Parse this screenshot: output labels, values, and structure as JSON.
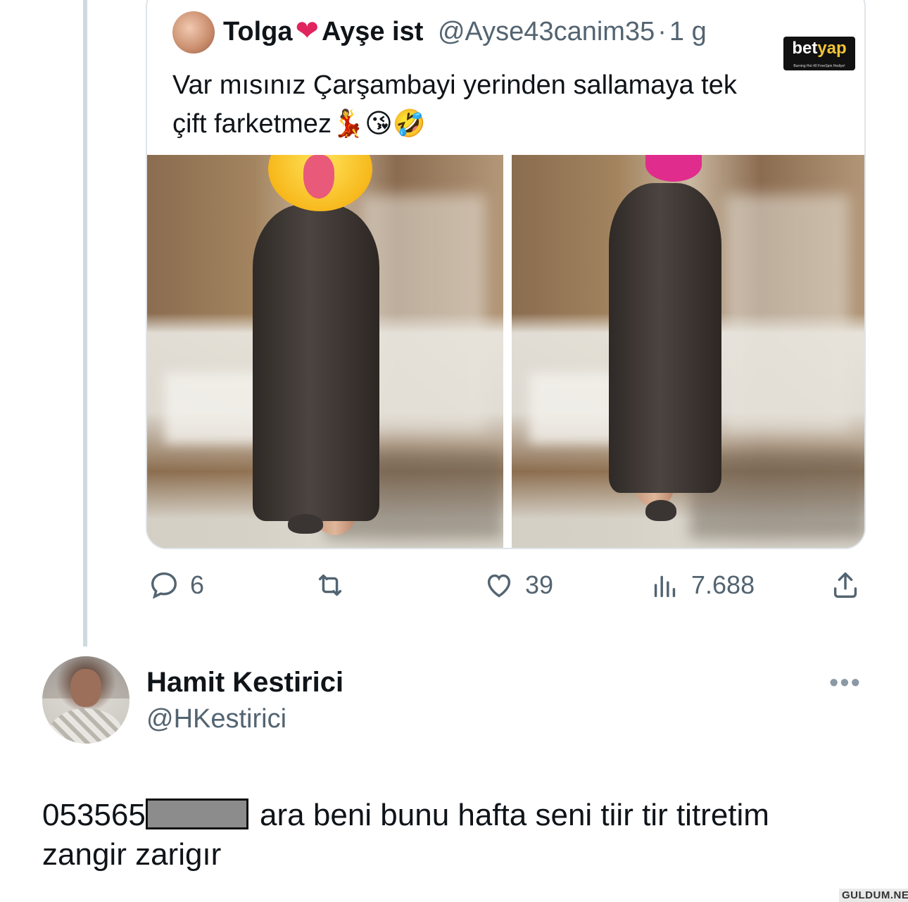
{
  "quoted_tweet": {
    "display_name": "Tolga",
    "display_name_2": "Ayşe ist",
    "handle": "@Ayse43canim35",
    "separator": "·",
    "time": "1 g",
    "text_line1": "Var mısınız Çarşambayi yerinden sallamaya tek",
    "text_line2": "çift farketmez",
    "text_emojis": "💃😘🤣",
    "heart": "❤"
  },
  "ad_badge": {
    "brand_a": "bet",
    "brand_b": "yap",
    "tagline": "Burning Hot 40 FreeSpin Hediye!"
  },
  "actions": {
    "replies": "6",
    "reposts": "",
    "likes": "39",
    "views": "7.688"
  },
  "reply": {
    "display_name": "Hamit Kestirici",
    "handle": "@HKestirici",
    "more": "•••",
    "text_prefix": "053565",
    "text_rest": " ara beni bunu hafta seni tiir tir titretim",
    "text_line2": "zangir zarigır"
  },
  "watermark": "GULDUM.NET",
  "colors": {
    "secondary_text": "#536471",
    "border": "#dfe4e8",
    "thread_line": "#cfd9de"
  }
}
